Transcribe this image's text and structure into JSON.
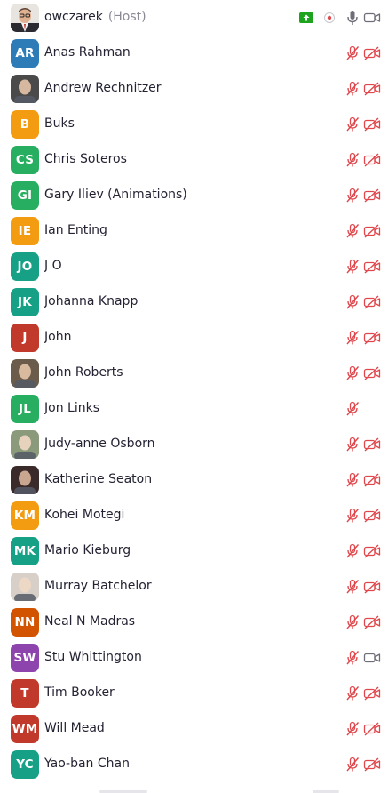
{
  "host": {
    "name": "owczarek",
    "tag": "(Host)"
  },
  "participants": [
    {
      "name": "Anas Rahman",
      "initials": "AR",
      "color": "#2e7cb7",
      "photo": false,
      "video_icon": "video-off-icon"
    },
    {
      "name": "Andrew Rechnitzer",
      "initials": "",
      "color": "#4a4a4a",
      "photo": true,
      "video_icon": "video-off-icon"
    },
    {
      "name": "Buks",
      "initials": "B",
      "color": "#f39c12",
      "photo": false,
      "video_icon": "video-off-icon"
    },
    {
      "name": "Chris Soteros",
      "initials": "CS",
      "color": "#27ae60",
      "photo": false,
      "video_icon": "video-off-icon"
    },
    {
      "name": "Gary Iliev (Animations)",
      "initials": "GI",
      "color": "#27ae60",
      "photo": false,
      "video_icon": "video-off-icon"
    },
    {
      "name": "Ian Enting",
      "initials": "IE",
      "color": "#f39c12",
      "photo": false,
      "video_icon": "video-off-icon"
    },
    {
      "name": "J O",
      "initials": "JO",
      "color": "#16a085",
      "photo": false,
      "video_icon": "video-off-icon"
    },
    {
      "name": "Johanna Knapp",
      "initials": "JK",
      "color": "#16a085",
      "photo": false,
      "video_icon": "video-off-icon"
    },
    {
      "name": "John",
      "initials": "J",
      "color": "#c0392b",
      "photo": false,
      "video_icon": "video-off-icon"
    },
    {
      "name": "John Roberts",
      "initials": "",
      "color": "#6b5b4b",
      "photo": true,
      "video_icon": "video-off-icon"
    },
    {
      "name": "Jon Links",
      "initials": "JL",
      "color": "#27ae60",
      "photo": false,
      "video_icon": ""
    },
    {
      "name": "Judy-anne Osborn",
      "initials": "",
      "color": "#8a9a7a",
      "photo": true,
      "video_icon": "video-off-icon"
    },
    {
      "name": "Katherine Seaton",
      "initials": "",
      "color": "#3a2a2a",
      "photo": true,
      "video_icon": "video-off-icon"
    },
    {
      "name": "Kohei Motegi",
      "initials": "KM",
      "color": "#f39c12",
      "photo": false,
      "video_icon": "video-off-icon"
    },
    {
      "name": "Mario Kieburg",
      "initials": "MK",
      "color": "#16a085",
      "photo": false,
      "video_icon": "video-off-icon"
    },
    {
      "name": "Murray Batchelor",
      "initials": "",
      "color": "#d8d0c8",
      "photo": true,
      "video_icon": "video-off-icon"
    },
    {
      "name": "Neal N Madras",
      "initials": "NN",
      "color": "#d35400",
      "photo": false,
      "video_icon": "video-off-icon"
    },
    {
      "name": "Stu Whittington",
      "initials": "SW",
      "color": "#8e44ad",
      "photo": false,
      "video_icon": "video-on-icon"
    },
    {
      "name": "Tim Booker",
      "initials": "T",
      "color": "#c0392b",
      "photo": false,
      "video_icon": "video-off-icon"
    },
    {
      "name": "Will Mead",
      "initials": "WM",
      "color": "#c0392b",
      "photo": false,
      "video_icon": "video-off-icon"
    },
    {
      "name": "Yao-ban Chan",
      "initials": "YC",
      "color": "#16a085",
      "photo": false,
      "video_icon": "video-off-icon"
    }
  ],
  "colors": {
    "muted_red": "#e0474c",
    "icon_gray": "#6e6e78",
    "share_green": "#1da31d",
    "text": "#232333"
  }
}
